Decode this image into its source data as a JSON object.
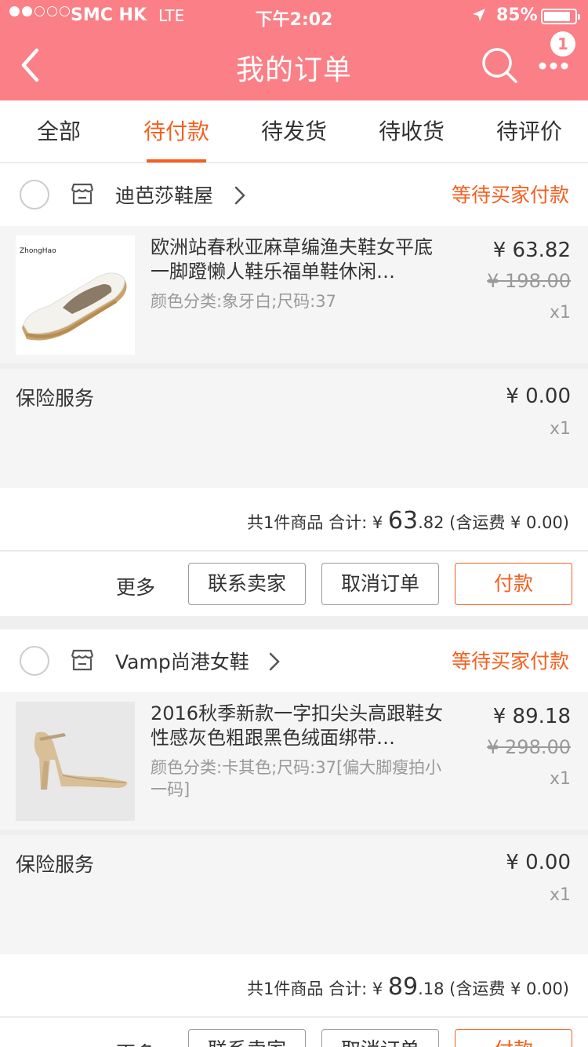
{
  "status_bar": {
    "carrier": "SMC HK",
    "network": "LTE",
    "time": "下午2:02",
    "battery": "85%"
  },
  "nav": {
    "title": "我的订单",
    "badge": "1"
  },
  "tabs": [
    {
      "label": "全部"
    },
    {
      "label": "待付款"
    },
    {
      "label": "待发货"
    },
    {
      "label": "待收货"
    },
    {
      "label": "待评价"
    }
  ],
  "active_tab": "待付款",
  "colors": {
    "header": "#fb7f86",
    "accent": "#f55f1f"
  },
  "orders": [
    {
      "shop": "迪芭莎鞋屋",
      "status": "等待买家付款",
      "item": {
        "title": "欧洲站春秋亚麻草编渔夫鞋女平底一脚蹬懒人鞋乐福单鞋休闲…",
        "spec": "颜色分类:象牙白;尺码:37",
        "price": "¥ 63.82",
        "original_price": "¥ 198.00",
        "qty": "x1",
        "thumb_logo": "ZhongHao"
      },
      "insurance": {
        "label": "保险服务",
        "price": "¥ 0.00",
        "qty": "x1"
      },
      "summary": {
        "count": "共1件商品 合计: ¥ ",
        "total_int": "63",
        "total_dec": ".82",
        "shipping": " (含运费 ¥ 0.00)"
      },
      "actions": {
        "more": "更多",
        "contact": "联系卖家",
        "cancel": "取消订单",
        "pay": "付款"
      }
    },
    {
      "shop": "Vamp尚港女鞋",
      "status": "等待买家付款",
      "item": {
        "title": "2016秋季新款一字扣尖头高跟鞋女性感灰色粗跟黑色绒面绑带…",
        "spec": "颜色分类:卡其色;尺码:37[偏大脚瘦拍小一码]",
        "price": "¥ 89.18",
        "original_price": "¥ 298.00",
        "qty": "x1"
      },
      "insurance": {
        "label": "保险服务",
        "price": "¥ 0.00",
        "qty": "x1"
      },
      "summary": {
        "count": "共1件商品 合计: ¥ ",
        "total_int": "89",
        "total_dec": ".18",
        "shipping": " (含运费 ¥ 0.00)"
      },
      "actions": {
        "more": "更多",
        "contact": "联系卖家",
        "cancel": "取消订单",
        "pay": "付款"
      }
    }
  ]
}
